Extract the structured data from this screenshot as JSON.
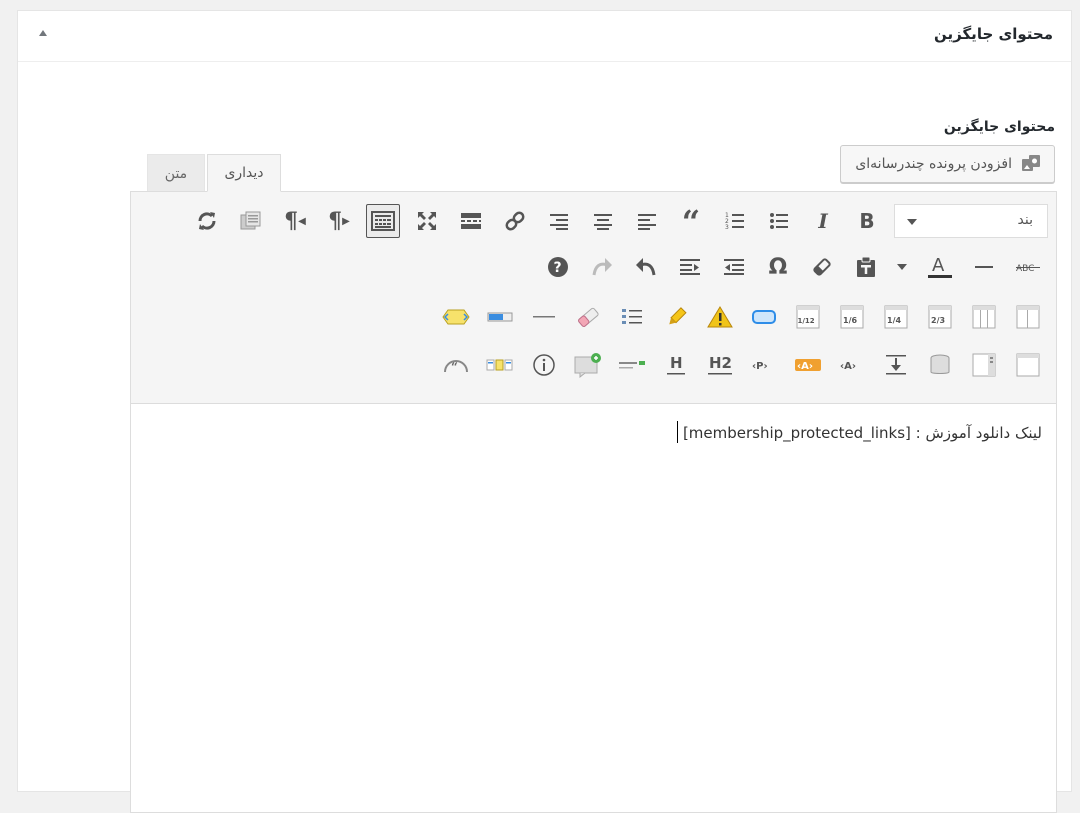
{
  "panel": {
    "title": "محتوای جایگزین"
  },
  "field": {
    "label": "محتوای جایگزین",
    "media_button_label": "افزودن پرونده چندرسانه‌ای"
  },
  "tabs": [
    {
      "label": "دیداری",
      "active": true
    },
    {
      "label": "متن",
      "active": false
    }
  ],
  "toolbar": {
    "format_select": "بند",
    "row1": [
      "bold-icon",
      "italic-icon",
      "bulleted-list-icon",
      "numbered-list-icon",
      "blockquote-icon",
      "align-left-icon",
      "align-center-icon",
      "align-right-icon",
      "link-icon",
      "read-more-icon",
      "fullscreen-icon",
      "toolbar-toggle-icon",
      "ltr-icon",
      "rtl-icon",
      "paste-from-word-icon",
      "refresh-icon"
    ],
    "row2": [
      "strikethrough-icon",
      "horizontal-line-icon",
      "text-color-icon",
      "text-color-dropdown-icon",
      "paste-as-text-icon",
      "clear-formatting-icon",
      "special-character-icon",
      "outdent-icon",
      "indent-icon",
      "undo-icon",
      "redo-icon",
      "help-icon"
    ],
    "row3": [
      "columns-icon",
      "columns-grid-icon",
      "two-thirds-icon",
      "one-quarter-icon",
      "one-sixth-icon",
      "one-twelfth-icon",
      "button-icon",
      "warning-icon",
      "highlight-icon",
      "list-icon",
      "eraser-icon",
      "divider-icon",
      "progress-icon",
      "toggle-icon"
    ],
    "row4": [
      "box-icon",
      "tabs-icon",
      "stack-icon",
      "spacer-icon",
      "heading-icon",
      "label-icon",
      "paragraph-icon",
      "h2-icon",
      "h-icon",
      "separator-icon",
      "message-icon",
      "info-icon",
      "pricing-icon",
      "testimonial-icon"
    ],
    "labels": {
      "ltr": "¶",
      "rtl": "¶",
      "special_char": "Ω",
      "text_color": "A",
      "bold": "B",
      "italic": "I",
      "blockquote": "“",
      "strike": "ABC",
      "help": "?",
      "h": "H",
      "h2": "H2",
      "tag_p": "‹P›",
      "tag_a": "‹A›",
      "frac_112": "1/12",
      "frac_16": "1/6",
      "frac_14": "1/4",
      "frac_23": "2/3"
    }
  },
  "editor": {
    "content_text": "لینک دانلود آموزش : [membership_protected_links]"
  },
  "colors": {
    "warning": "#f0c419",
    "button_blue": "#2e8de8",
    "highlight_yellow": "#f5c518",
    "orange_tag": "#f0a030",
    "toggle_yellow": "#f7e26b"
  }
}
